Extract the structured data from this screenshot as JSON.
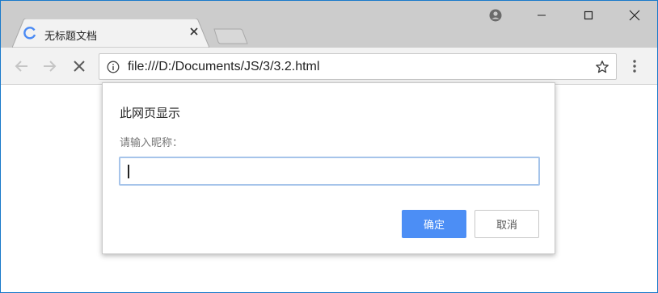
{
  "tab": {
    "title": "无标题文档",
    "spinner_icon": "loading-spinner-icon",
    "close_icon": "close-icon"
  },
  "window_controls": [
    "profile-icon",
    "minimize-icon",
    "maximize-icon",
    "close-icon"
  ],
  "toolbar": {
    "back_icon": "arrow-left-icon",
    "forward_icon": "arrow-right-icon",
    "stop_icon": "stop-icon",
    "url": "file:///D:/Documents/JS/3/3.2.html",
    "info_icon": "info-icon",
    "star_icon": "star-icon",
    "menu_icon": "kebab-menu-icon"
  },
  "dialog": {
    "title": "此网页显示",
    "message": "请输入昵称：",
    "input_value": "",
    "ok_label": "确定",
    "cancel_label": "取消"
  },
  "colors": {
    "accent": "#4c8ef5",
    "spinner": "#4a8af4",
    "tabstrip": "#cccccc",
    "toolbar": "#f2f2f2",
    "input_focus": "#a6c4ea"
  }
}
